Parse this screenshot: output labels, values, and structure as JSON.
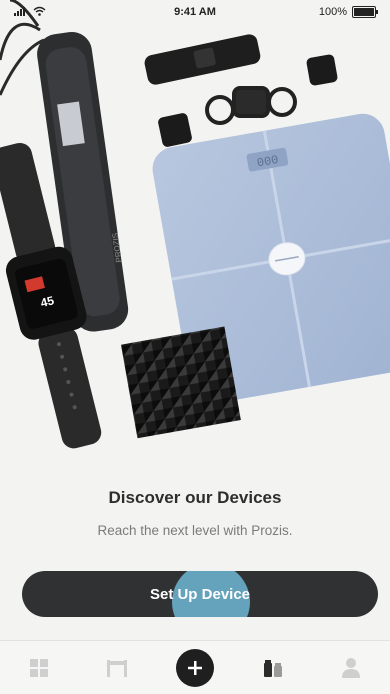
{
  "status_bar": {
    "time": "9:41 AM",
    "battery": "100%",
    "icons": [
      "signal-icon",
      "wifi-icon",
      "battery-icon"
    ]
  },
  "hero": {
    "scale_display": "000",
    "watch_display": "45",
    "tracker_brand": "PROZIS"
  },
  "content": {
    "title": "Discover our Devices",
    "subtitle": "Reach the next level with Prozis."
  },
  "cta": {
    "label": "Set Up Device"
  },
  "tabbar": {
    "tabs": [
      {
        "icon": "grid-icon",
        "active": false
      },
      {
        "icon": "bed-icon",
        "active": false
      },
      {
        "icon": "plus-icon",
        "active": true
      },
      {
        "icon": "supplement-icon",
        "active": false
      },
      {
        "icon": "profile-icon",
        "active": false
      }
    ]
  },
  "colors": {
    "background": "#f3f3f2",
    "button": "#2f3133",
    "scale": "#aebfd9",
    "tap_highlight": "#78c8eb"
  }
}
